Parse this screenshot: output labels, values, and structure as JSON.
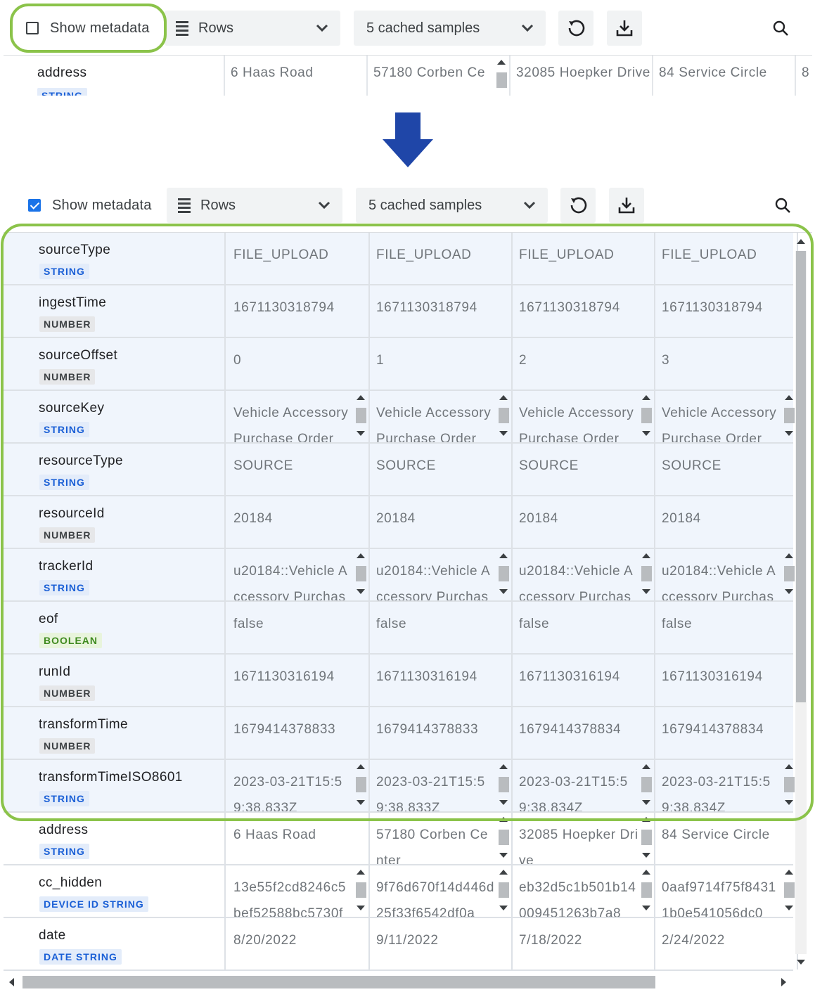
{
  "colors": {
    "highlight": "#8bc34a",
    "accent": "#1a73e8",
    "arrow": "#1f46a8"
  },
  "toolbar_before": {
    "show_metadata_label": "Show metadata",
    "show_metadata_checked": false,
    "view_select": "Rows",
    "samples_select": "5 cached samples",
    "refresh_icon": "refresh-icon",
    "download_icon": "download-icon",
    "search_icon": "search-icon"
  },
  "strip": {
    "field": "address",
    "type": "STRING",
    "values": [
      "6 Haas Road",
      "57180 Corben Ce",
      "32085 Hoepker Drive",
      "84 Service Circle",
      "8"
    ]
  },
  "transition_icon": "arrow-down-icon",
  "toolbar_after": {
    "show_metadata_label": "Show metadata",
    "show_metadata_checked": true,
    "view_select": "Rows",
    "samples_select": "5 cached samples",
    "refresh_icon": "refresh-icon",
    "download_icon": "download-icon",
    "search_icon": "search-icon"
  },
  "rows": [
    {
      "field": "sourceType",
      "type": "STRING",
      "meta": true,
      "scroll": false,
      "values": [
        "FILE_UPLOAD",
        "FILE_UPLOAD",
        "FILE_UPLOAD",
        "FILE_UPLOAD"
      ]
    },
    {
      "field": "ingestTime",
      "type": "NUMBER",
      "meta": true,
      "scroll": false,
      "values": [
        "1671130318794",
        "1671130318794",
        "1671130318794",
        "1671130318794"
      ]
    },
    {
      "field": "sourceOffset",
      "type": "NUMBER",
      "meta": true,
      "scroll": false,
      "values": [
        "0",
        "1",
        "2",
        "3"
      ]
    },
    {
      "field": "sourceKey",
      "type": "STRING",
      "meta": true,
      "scroll": true,
      "values": [
        "Vehicle Accessory Purchase Order",
        "Vehicle Accessory Purchase Order",
        "Vehicle Accessory Purchase Order",
        "Vehicle Accessory Purchase Order"
      ]
    },
    {
      "field": "resourceType",
      "type": "STRING",
      "meta": true,
      "scroll": false,
      "values": [
        "SOURCE",
        "SOURCE",
        "SOURCE",
        "SOURCE"
      ]
    },
    {
      "field": "resourceId",
      "type": "NUMBER",
      "meta": true,
      "scroll": false,
      "values": [
        "20184",
        "20184",
        "20184",
        "20184"
      ]
    },
    {
      "field": "trackerId",
      "type": "STRING",
      "meta": true,
      "scroll": true,
      "values": [
        "u20184::Vehicle Accessory Purchas",
        "u20184::Vehicle Accessory Purchas",
        "u20184::Vehicle Accessory Purchas",
        "u20184::Vehicle Accessory Purchas"
      ]
    },
    {
      "field": "eof",
      "type": "BOOLEAN",
      "meta": true,
      "scroll": false,
      "values": [
        "false",
        "false",
        "false",
        "false"
      ]
    },
    {
      "field": "runId",
      "type": "NUMBER",
      "meta": true,
      "scroll": false,
      "values": [
        "1671130316194",
        "1671130316194",
        "1671130316194",
        "1671130316194"
      ]
    },
    {
      "field": "transformTime",
      "type": "NUMBER",
      "meta": true,
      "scroll": false,
      "values": [
        "1679414378833",
        "1679414378833",
        "1679414378834",
        "1679414378834"
      ]
    },
    {
      "field": "transformTimeISO8601",
      "type": "STRING",
      "meta": true,
      "scroll": true,
      "values": [
        "2023-03-21T15:59:38.833Z",
        "2023-03-21T15:59:38.833Z",
        "2023-03-21T15:59:38.834Z",
        "2023-03-21T15:59:38.834Z"
      ]
    },
    {
      "field": "address",
      "type": "STRING",
      "meta": false,
      "scroll": false,
      "scrollCols": [
        1,
        2
      ],
      "values": [
        "6 Haas Road",
        "57180 Corben Center",
        "32085 Hoepker Drive",
        "84 Service Circle"
      ]
    },
    {
      "field": "cc_hidden",
      "type": "DEVICE ID STRING",
      "meta": false,
      "scroll": true,
      "values": [
        "13e55f2cd8246c5bef52588bc5730f",
        "9f76d670f14d446d25f33f6542df0a",
        "eb32d5c1b501b14009451263b7a8",
        "0aaf9714f75f84311b0e541056dc0"
      ]
    },
    {
      "field": "date",
      "type": "DATE STRING",
      "meta": false,
      "scroll": false,
      "values": [
        "8/20/2022",
        "9/11/2022",
        "7/18/2022",
        "2/24/2022"
      ]
    }
  ]
}
